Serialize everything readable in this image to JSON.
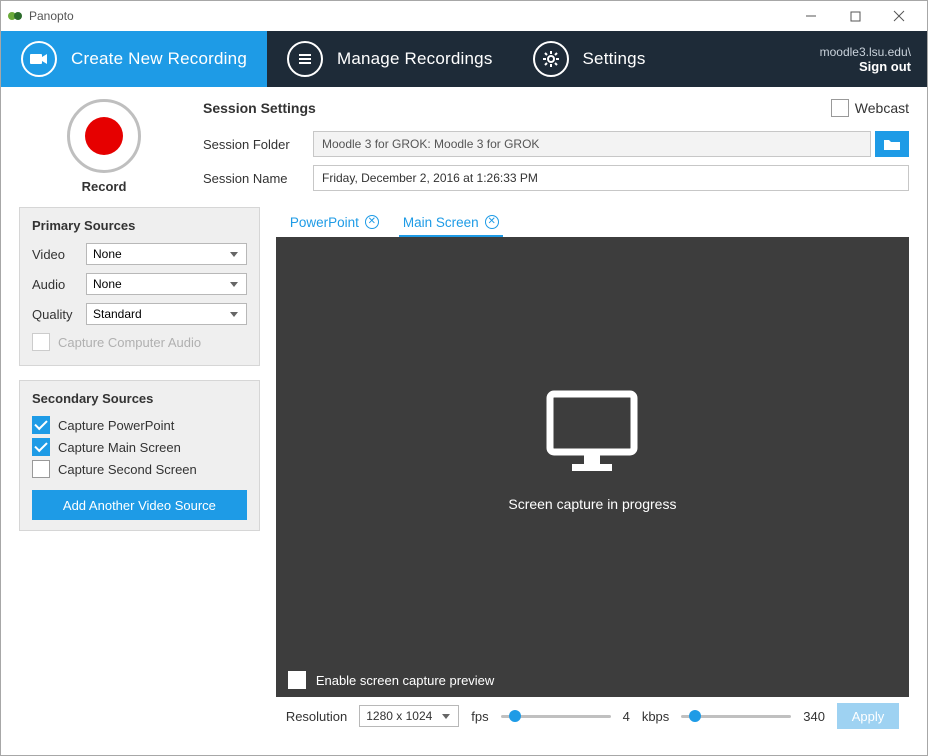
{
  "titlebar": {
    "app_name": "Panopto"
  },
  "nav": {
    "create": "Create New Recording",
    "manage": "Manage Recordings",
    "settings": "Settings",
    "host": "moodle3.lsu.edu\\",
    "signout": "Sign out"
  },
  "record": {
    "label": "Record"
  },
  "session": {
    "title": "Session Settings",
    "webcast_label": "Webcast",
    "folder_label": "Session Folder",
    "folder_value": "Moodle 3 for GROK: Moodle 3 for GROK",
    "name_label": "Session Name",
    "name_value": "Friday, December 2, 2016 at 1:26:33 PM"
  },
  "primary": {
    "title": "Primary Sources",
    "video_label": "Video",
    "video_value": "None",
    "audio_label": "Audio",
    "audio_value": "None",
    "quality_label": "Quality",
    "quality_value": "Standard",
    "capture_audio": "Capture Computer Audio"
  },
  "secondary": {
    "title": "Secondary Sources",
    "ppt": "Capture PowerPoint",
    "main": "Capture Main Screen",
    "second": "Capture Second Screen",
    "add_button": "Add Another Video Source"
  },
  "tabs": {
    "ppt": "PowerPoint",
    "main": "Main Screen"
  },
  "preview": {
    "message": "Screen capture in progress",
    "enable_preview": "Enable screen capture preview"
  },
  "footer": {
    "resolution_label": "Resolution",
    "resolution_value": "1280 x 1024",
    "fps_label": "fps",
    "fps_value": "4",
    "kbps_label": "kbps",
    "kbps_value": "340",
    "apply": "Apply"
  }
}
